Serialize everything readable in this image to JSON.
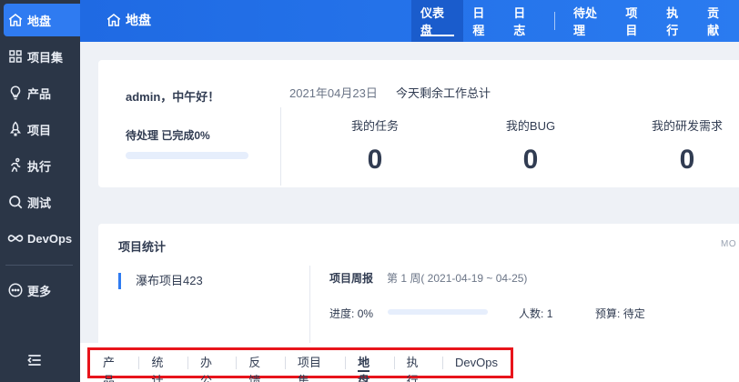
{
  "sidebar": {
    "items": [
      {
        "label": "地盘",
        "icon": "home-icon"
      },
      {
        "label": "项目集",
        "icon": "grid-icon"
      },
      {
        "label": "产品",
        "icon": "lightbulb-icon"
      },
      {
        "label": "项目",
        "icon": "rocket-icon"
      },
      {
        "label": "执行",
        "icon": "running-icon"
      },
      {
        "label": "测试",
        "icon": "magnifier-icon"
      },
      {
        "label": "DevOps",
        "icon": "infinity-icon"
      },
      {
        "label": "更多",
        "icon": "more-dots-icon"
      }
    ],
    "toggle_icon": "collapse-menu-icon",
    "accent": "#2f7bf1"
  },
  "header": {
    "title": "地盘",
    "nav_left": [
      "仪表盘",
      "日程",
      "日志"
    ],
    "nav_right": [
      "待处理",
      "项目",
      "执行",
      "贡献"
    ],
    "active": "仪表盘"
  },
  "welcome": {
    "greeting": "admin，中午好！",
    "pending": "待处理 已完成0%",
    "progress": 0,
    "date": "2021年04月23日",
    "summary_title": "今天剩余工作总计",
    "stats": [
      {
        "label": "我的任务",
        "value": "0"
      },
      {
        "label": "我的BUG",
        "value": "0"
      },
      {
        "label": "我的研发需求",
        "value": "0"
      }
    ]
  },
  "project_stats": {
    "title": "项目统计",
    "more": "MO",
    "project_name": "瀑布项目423",
    "week_label": "项目周报",
    "week_value": "第 1 周( 2021-04-19 ~ 04-25)",
    "progress_label": "进度:",
    "progress_value": "0%",
    "progress": 0,
    "people_label": "人数:",
    "people_value": "1",
    "budget_label": "预算:",
    "budget_value": "待定"
  },
  "bottom_tabs": {
    "items": [
      "产品",
      "统计",
      "办公",
      "反馈",
      "项目集",
      "地盘",
      "执行",
      "DevOps"
    ],
    "active": "地盘",
    "highlight_color": "#e8141b"
  }
}
